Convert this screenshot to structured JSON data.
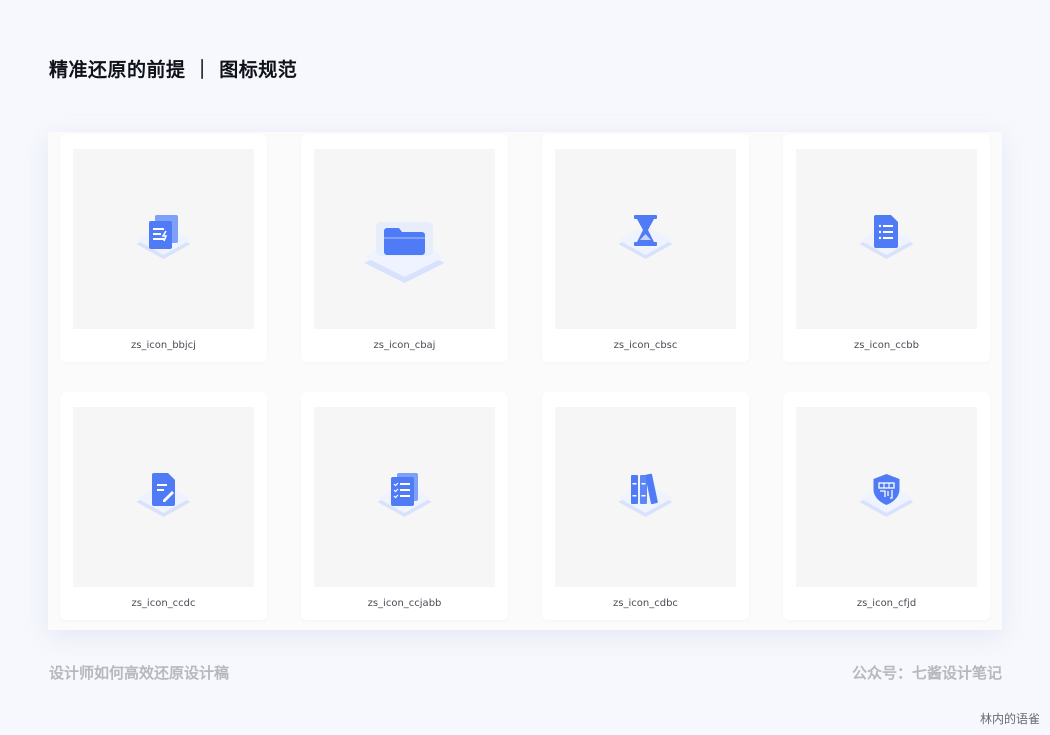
{
  "header": {
    "title": "精准还原的前提 ｜ 图标规范"
  },
  "icons": [
    {
      "label": "zs_icon_bbjcj",
      "glyph": "document-stack-icon"
    },
    {
      "label": "zs_icon_cbaj",
      "glyph": "folder-icon"
    },
    {
      "label": "zs_icon_cbsc",
      "glyph": "hourglass-icon"
    },
    {
      "label": "zs_icon_ccbb",
      "glyph": "list-document-icon"
    },
    {
      "label": "zs_icon_ccdc",
      "glyph": "edit-document-icon"
    },
    {
      "label": "zs_icon_ccjabb",
      "glyph": "checklist-document-icon"
    },
    {
      "label": "zs_icon_cdbc",
      "glyph": "books-icon"
    },
    {
      "label": "zs_icon_cfjd",
      "glyph": "penalty-shield-icon"
    }
  ],
  "footer": {
    "left": "设计师如何高效还原设计稿",
    "right": "公众号：七酱设计笔记"
  },
  "watermark": "林内的语雀",
  "colors": {
    "page_background": "#f6f8fd",
    "icon_blue": "#4f7cf6",
    "icon_light": "#c5d4fb",
    "thumb_background": "#f6f6f6"
  }
}
